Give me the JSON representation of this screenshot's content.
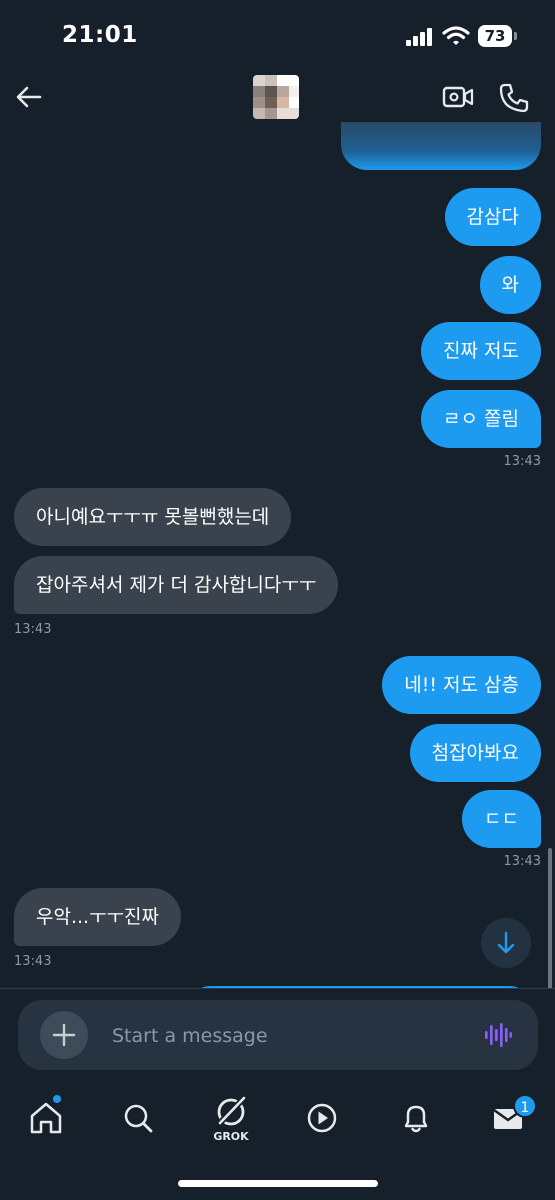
{
  "status_bar": {
    "time": "21:01",
    "battery": "73"
  },
  "composer": {
    "placeholder": "Start a message"
  },
  "messages": [
    {
      "dir": "out",
      "text": "감삼다"
    },
    {
      "dir": "out",
      "text": "와"
    },
    {
      "dir": "out",
      "text": "진짜 저도"
    },
    {
      "dir": "out",
      "text": "ㄹㅇ 쫄림"
    },
    {
      "dir": "in",
      "text": "아니예요ㅜㅜㅠ 못볼뻔했는데"
    },
    {
      "dir": "in",
      "text": "잡아주셔서 제가 더 감사합니다ㅜㅜ"
    },
    {
      "dir": "out",
      "text": "네!! 저도 삼층"
    },
    {
      "dir": "out",
      "text": "첨잡아봐요"
    },
    {
      "dir": "out",
      "text": "ㄷㄷ"
    },
    {
      "dir": "in",
      "text": "우악...ㅜㅜ진짜"
    }
  ],
  "timestamps": [
    "13:43",
    "13:43",
    "13:43",
    "13:43"
  ],
  "tabbar": {
    "grok_label": "GROK",
    "messages_badge": "1"
  },
  "colors": {
    "accent": "#1d9bf0",
    "background": "#15202b",
    "incoming_bubble": "#3a434d"
  },
  "icons": [
    "back-arrow-icon",
    "video-call-icon",
    "phone-icon",
    "plus-icon",
    "voice-wave-icon",
    "home-icon",
    "search-icon",
    "grok-icon",
    "play-icon",
    "bell-icon",
    "mail-icon",
    "arrow-down-icon"
  ]
}
